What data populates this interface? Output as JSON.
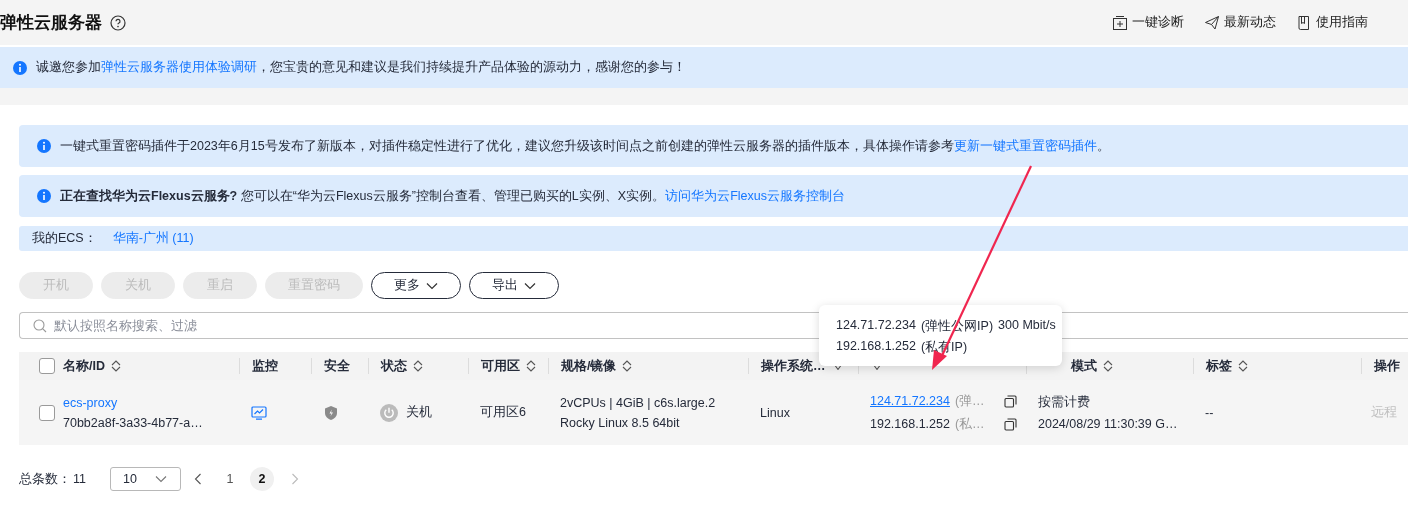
{
  "page": {
    "title": "弹性云服务器"
  },
  "header_actions": [
    {
      "kind": "diagnose",
      "label": "一键诊断"
    },
    {
      "kind": "news",
      "label": "最新动态"
    },
    {
      "kind": "guide",
      "label": "使用指南"
    }
  ],
  "survey_banner": {
    "text_before": "诚邀您参加",
    "link": "弹性云服务器使用体验调研",
    "text_after": "，您宝贵的意见和建议是我们持续提升产品体验的源动力，感谢您的参与！"
  },
  "alerts": [
    {
      "text": "一键式重置密码插件于2023年6月15号发布了新版本，对插件稳定性进行了优化，建议您升级该时间点之前创建的弹性云服务器的插件版本，具体操作请参考",
      "link": "更新一键式重置密码插件",
      "text_after": "。"
    },
    {
      "text": "**正在查找华为云Flexus云服务?** 您可以在“华为云Flexus云服务”控制台查看、管理已购买的L实例、X实例。",
      "link": "访问华为云Flexus云服务控制台"
    }
  ],
  "region_bar": {
    "label": "我的ECS：",
    "region": "华南-广州 (11)"
  },
  "actions": [
    {
      "label": "开机",
      "disabled": true,
      "dropdown": false
    },
    {
      "label": "关机",
      "disabled": true,
      "dropdown": false
    },
    {
      "label": "重启",
      "disabled": true,
      "dropdown": false
    },
    {
      "label": "重置密码",
      "disabled": true,
      "dropdown": false
    },
    {
      "label": "更多",
      "disabled": false,
      "dropdown": true
    },
    {
      "label": "导出",
      "disabled": false,
      "dropdown": true
    }
  ],
  "search": {
    "placeholder": "默认按照名称搜索、过滤"
  },
  "table": {
    "select_all": {
      "checked": false
    },
    "columns": [
      {
        "label": "名称/ID",
        "kind": "sort"
      },
      {
        "label": "监控",
        "kind": "plain"
      },
      {
        "label": "安全",
        "kind": "plain"
      },
      {
        "label": "状态",
        "kind": "sort"
      },
      {
        "label": "可用区",
        "kind": "sort"
      },
      {
        "label": "规格/镜像",
        "kind": "sort"
      },
      {
        "label": "操作系统…",
        "kind": "filter"
      },
      {
        "kind": "filter"
      },
      {
        "label": "模式",
        "kind": "sort"
      },
      {
        "label": "标签",
        "kind": "sort"
      },
      {
        "label": "操作",
        "kind": "plain"
      }
    ],
    "rows": [
      {
        "selected": false,
        "name": "ecs-proxy",
        "id": "70bb2a8f-3a33-4b77-a…",
        "status": "关机",
        "zone": "可用区6",
        "spec": "2vCPUs | 4GiB | c6s.large.2",
        "image": "Rocky Linux 8.5 64bit",
        "os": "Linux",
        "ips": [
          {
            "address": "124.71.72.234",
            "link": true,
            "type": "(弹…"
          },
          {
            "address": "192.168.1.252",
            "link": false,
            "type": "(私…"
          }
        ],
        "billing": "按需计费",
        "created": "2024/08/29 11:30:39 G…",
        "tags": "--",
        "action": "远程"
      }
    ]
  },
  "tooltip": {
    "lines": [
      {
        "ip": "124.71.72.234",
        "type": "(弹性公网IP)",
        "bandwidth": "300 Mbit/s"
      },
      {
        "ip": "192.168.1.252",
        "type": "(私有IP)"
      }
    ]
  },
  "pagination": {
    "total_label": "总条数：",
    "total": "11",
    "page_size": "10",
    "pages": [
      {
        "label": "1",
        "selected": false
      },
      {
        "label": "2",
        "selected": true
      }
    ]
  },
  "annotations": [
    {
      "kind": "arrow"
    }
  ]
}
